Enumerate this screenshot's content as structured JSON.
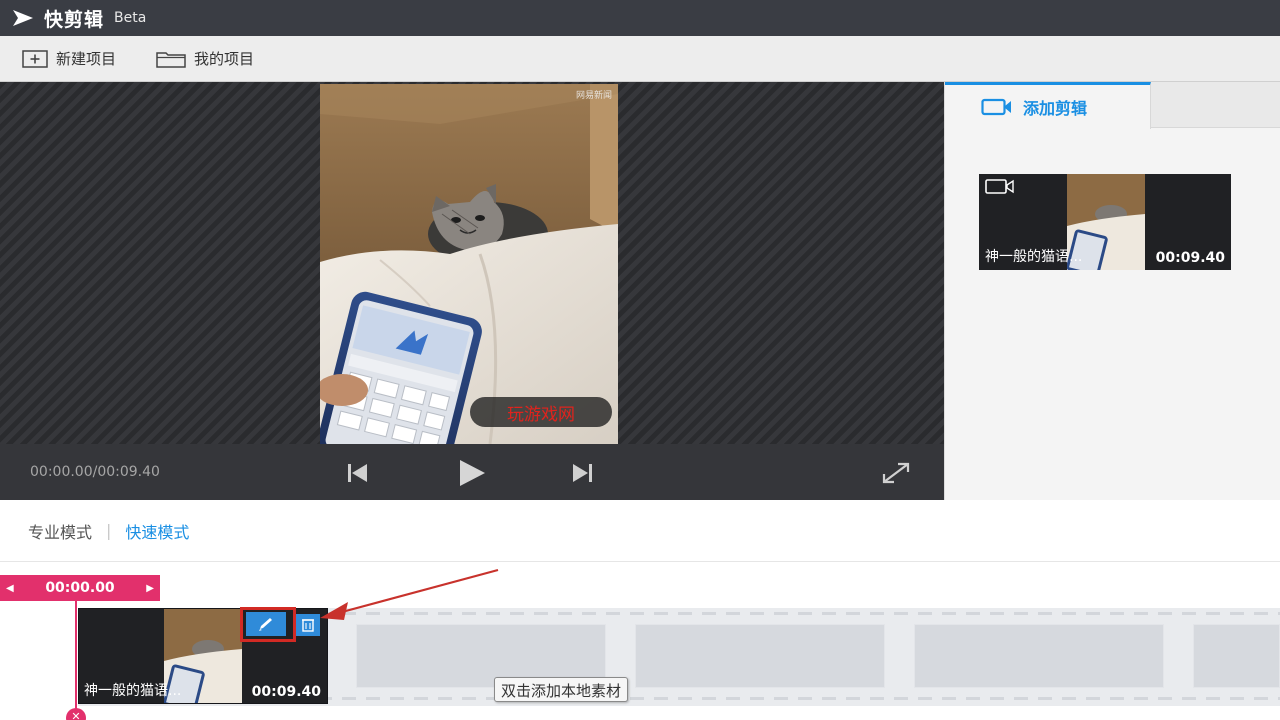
{
  "app": {
    "name": "快剪辑",
    "beta": "Beta"
  },
  "toolbar": {
    "new_project": "新建项目",
    "my_projects": "我的项目"
  },
  "player": {
    "watermark_top": "网易新闻",
    "watermark_pill": "玩游戏网",
    "timecode": "00:00.00/00:09.40"
  },
  "right_panel": {
    "tab_label": "添加剪辑",
    "clip": {
      "name": "神一般的猫语...",
      "duration": "00:09.40"
    }
  },
  "modes": {
    "pro": "专业模式",
    "separator": "|",
    "quick": "快速模式",
    "active": "quick"
  },
  "timeline": {
    "playhead_time": "00:00.00",
    "clip": {
      "name": "神一般的猫语...",
      "duration": "00:09.40"
    },
    "tooltip": "双击添加本地素材"
  },
  "colors": {
    "accent": "#1a8fe3",
    "playhead": "#e2306c",
    "annotation": "#d22a24"
  }
}
